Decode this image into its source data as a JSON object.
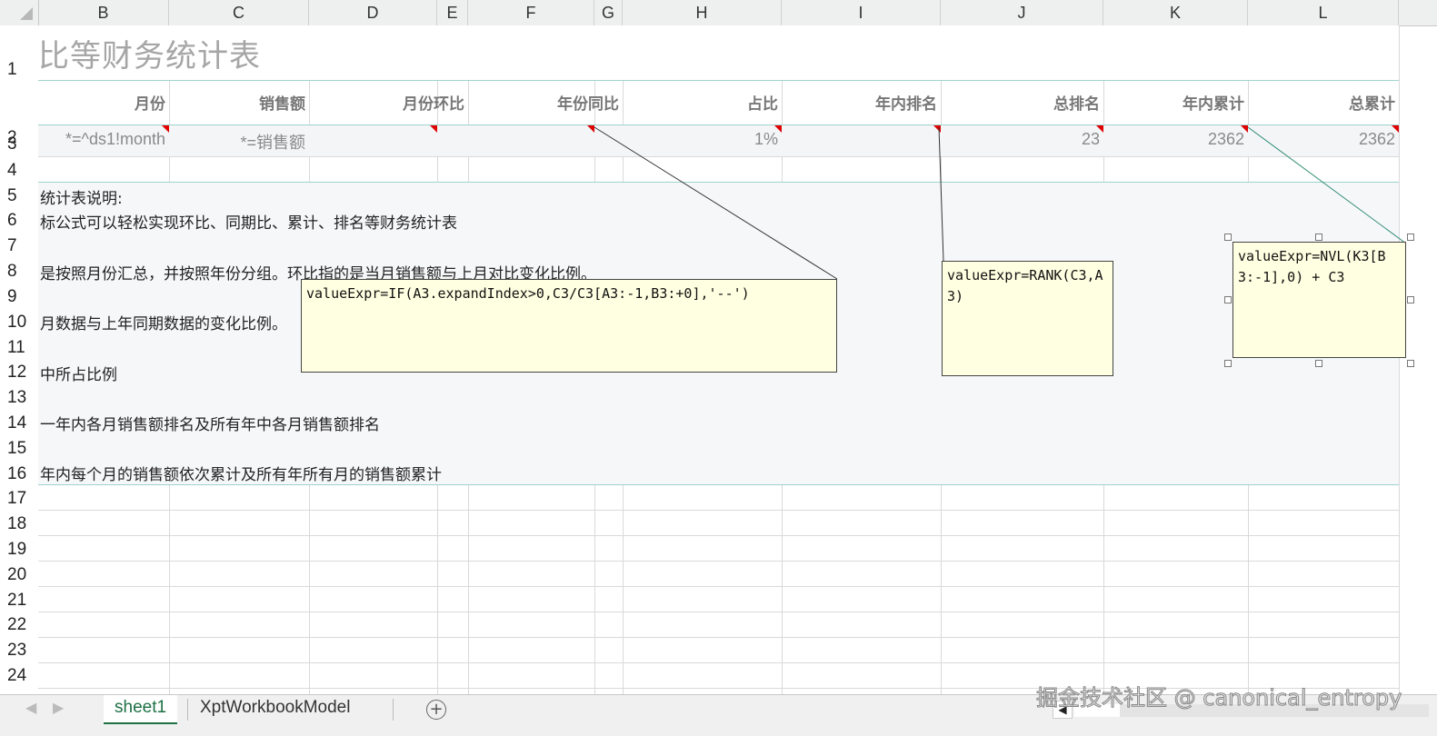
{
  "columns": [
    "B",
    "C",
    "D",
    "E",
    "F",
    "G",
    "H",
    "I",
    "J",
    "K",
    "L"
  ],
  "rows": [
    "1",
    "2",
    "3",
    "4",
    "5",
    "6",
    "7",
    "8",
    "9",
    "10",
    "11",
    "12",
    "13",
    "14",
    "15",
    "16",
    "17",
    "18",
    "19",
    "20",
    "21",
    "22",
    "23",
    "24"
  ],
  "title": "比等财务统计表",
  "header_row": [
    "月份",
    "销售额",
    "月份环比",
    "年份同比",
    "占比",
    "年内排名",
    "总排名",
    "年内累计",
    "总累计"
  ],
  "data_row": {
    "month": "*=^ds1!month",
    "sales": "*=销售额",
    "ratio": "1%",
    "total_rank": "23",
    "year_cum": "2362",
    "total_cum": "2362"
  },
  "notes": {
    "r5": "统计表说明:",
    "r6": "标公式可以轻松实现环比、同期比、累计、排名等财务统计表",
    "r8": "是按照月份汇总，并按照年份分组。环比指的是当月销售额与上月对比变化比例。",
    "r10": "月数据与上年同期数据的变化比例。",
    "r12": "中所占比例",
    "r14": "一年内各月销售额排名及所有年中各月销售额排名",
    "r16": "年内每个月的销售额依次累计及所有年所有月的销售额累计"
  },
  "comments": {
    "yoy": "valueExpr=IF(A3.expandIndex>0,C3/C3[A3:-1,B3:+0],'--')",
    "rank": "valueExpr=RANK(C3,A3)",
    "cumulative": "valueExpr=NVL(K3[B3:-1],0) + C3"
  },
  "tabs": [
    "sheet1",
    "XptWorkbookModel"
  ],
  "add_sheet_icon": "plus-circle-icon",
  "watermark": "掘金技术社区 @ canonical_entropy",
  "colors": {
    "accent": "#1e7145",
    "comment_bg": "#ffffe1",
    "marker": "#e00000",
    "title": "#a6a6a6"
  }
}
